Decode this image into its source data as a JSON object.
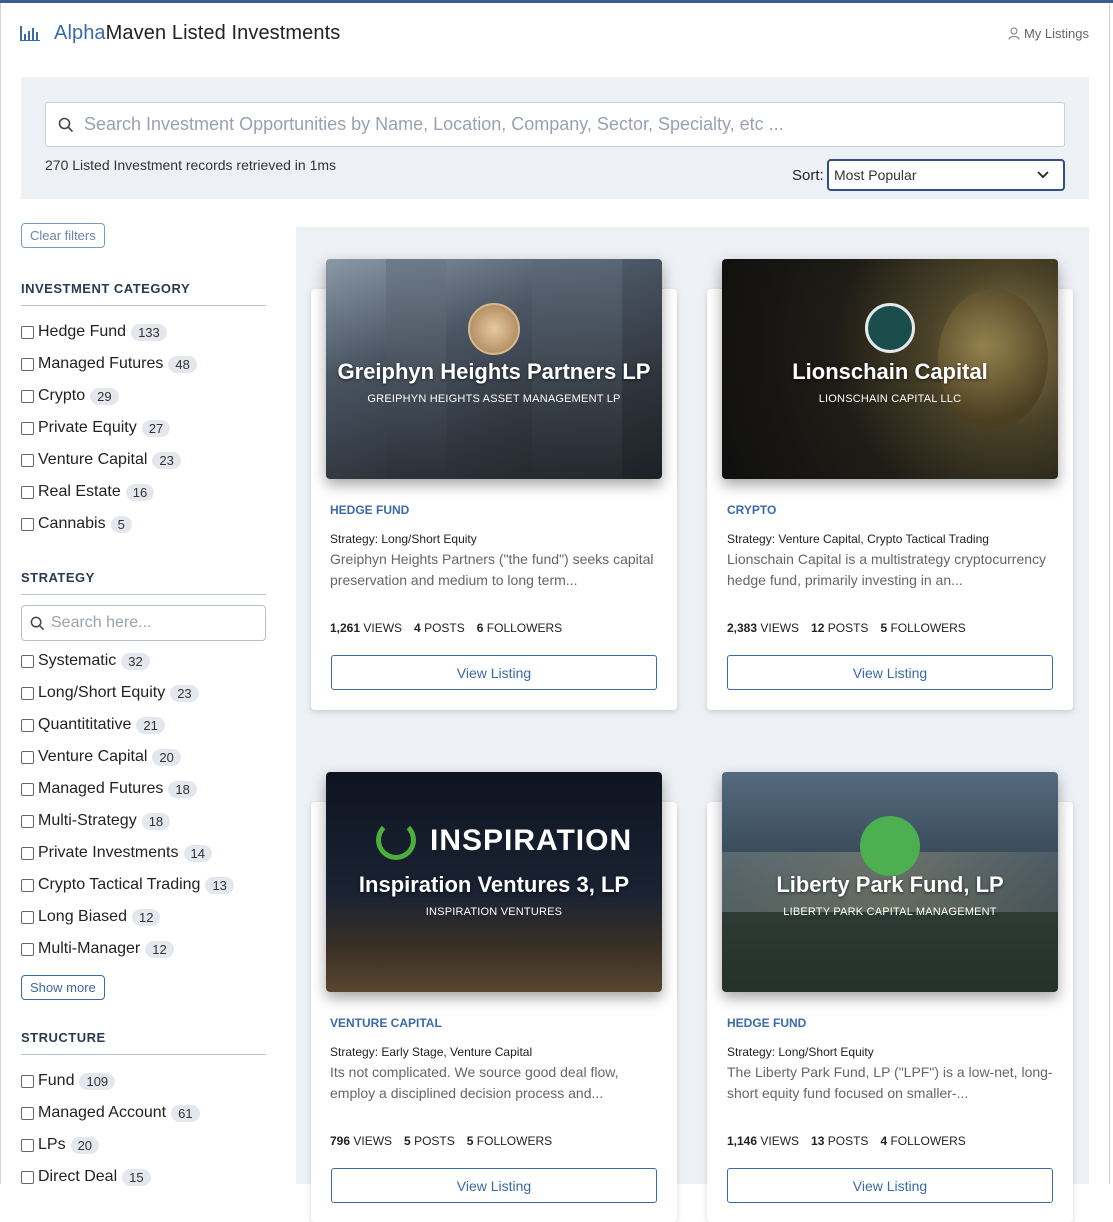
{
  "header": {
    "title_a": "Alpha",
    "title_b": "Maven Listed Investments",
    "my_listings": "My Listings"
  },
  "search": {
    "placeholder": "Search Investment Opportunities by Name, Location, Company, Sector, Specialty, etc ...",
    "records": "270 Listed Investment records retrieved in 1ms",
    "sort_label": "Sort:",
    "sort_value": "Most Popular"
  },
  "sidebar": {
    "clear": "Clear filters",
    "category": {
      "title": "INVESTMENT CATEGORY",
      "items": [
        {
          "label": "Hedge Fund",
          "count": "133"
        },
        {
          "label": "Managed Futures",
          "count": "48"
        },
        {
          "label": "Crypto",
          "count": "29"
        },
        {
          "label": "Private Equity",
          "count": "27"
        },
        {
          "label": "Venture Capital",
          "count": "23"
        },
        {
          "label": "Real Estate",
          "count": "16"
        },
        {
          "label": "Cannabis",
          "count": "5"
        }
      ]
    },
    "strategy": {
      "title": "STRATEGY",
      "placeholder": "Search here...",
      "items": [
        {
          "label": "Systematic",
          "count": "32"
        },
        {
          "label": "Long/Short Equity",
          "count": "23"
        },
        {
          "label": "Quantititative",
          "count": "21"
        },
        {
          "label": "Venture Capital",
          "count": "20"
        },
        {
          "label": "Managed Futures",
          "count": "18"
        },
        {
          "label": "Multi-Strategy",
          "count": "18"
        },
        {
          "label": "Private Investments",
          "count": "14"
        },
        {
          "label": "Crypto Tactical Trading",
          "count": "13"
        },
        {
          "label": "Long Biased",
          "count": "12"
        },
        {
          "label": "Multi-Manager",
          "count": "12"
        }
      ],
      "show_more": "Show more"
    },
    "structure": {
      "title": "STRUCTURE",
      "items": [
        {
          "label": "Fund",
          "count": "109"
        },
        {
          "label": "Managed Account",
          "count": "61"
        },
        {
          "label": "LPs",
          "count": "20"
        },
        {
          "label": "Direct Deal",
          "count": "15"
        }
      ]
    }
  },
  "cards": [
    {
      "name": "Greiphyn Heights Partners LP",
      "company": "GREIPHYN HEIGHTS ASSET MANAGEMENT LP",
      "category": "HEDGE FUND",
      "strategy": "Strategy: Long/Short Equity",
      "desc": "Greiphyn Heights Partners (\"the fund\") seeks capital preservation and medium to long term...",
      "views": "1,261",
      "posts": "4",
      "followers": "6",
      "button": "View Listing"
    },
    {
      "name": "Lionschain Capital",
      "company": "LIONSCHAIN CAPITAL LLC",
      "category": "CRYPTO",
      "strategy": "Strategy: Venture Capital, Crypto Tactical Trading",
      "desc": "Lionschain Capital is a multistrategy cryptocurrency hedge fund, primarily investing in an...",
      "views": "2,383",
      "posts": "12",
      "followers": "5",
      "button": "View Listing"
    },
    {
      "name": "Inspiration Ventures 3, LP",
      "company": "INSPIRATION VENTURES",
      "brand": "INSPIRATION",
      "category": "VENTURE CAPITAL",
      "strategy": "Strategy: Early Stage, Venture Capital",
      "desc": "Its not complicated. We source good deal flow, employ a disciplined decision process and...",
      "views": "796",
      "posts": "5",
      "followers": "5",
      "button": "View Listing"
    },
    {
      "name": "Liberty Park Fund, LP",
      "company": "LIBERTY PARK CAPITAL MANAGEMENT",
      "category": "HEDGE FUND",
      "strategy": "Strategy: Long/Short Equity",
      "desc": "The Liberty Park Fund, LP (\"LPF\") is a low-net, long-short equity fund focused on smaller-...",
      "views": "1,146",
      "posts": "13",
      "followers": "4",
      "button": "View Listing"
    }
  ],
  "labels": {
    "views": "VIEWS",
    "posts": "POSTS",
    "followers": "FOLLOWERS"
  }
}
